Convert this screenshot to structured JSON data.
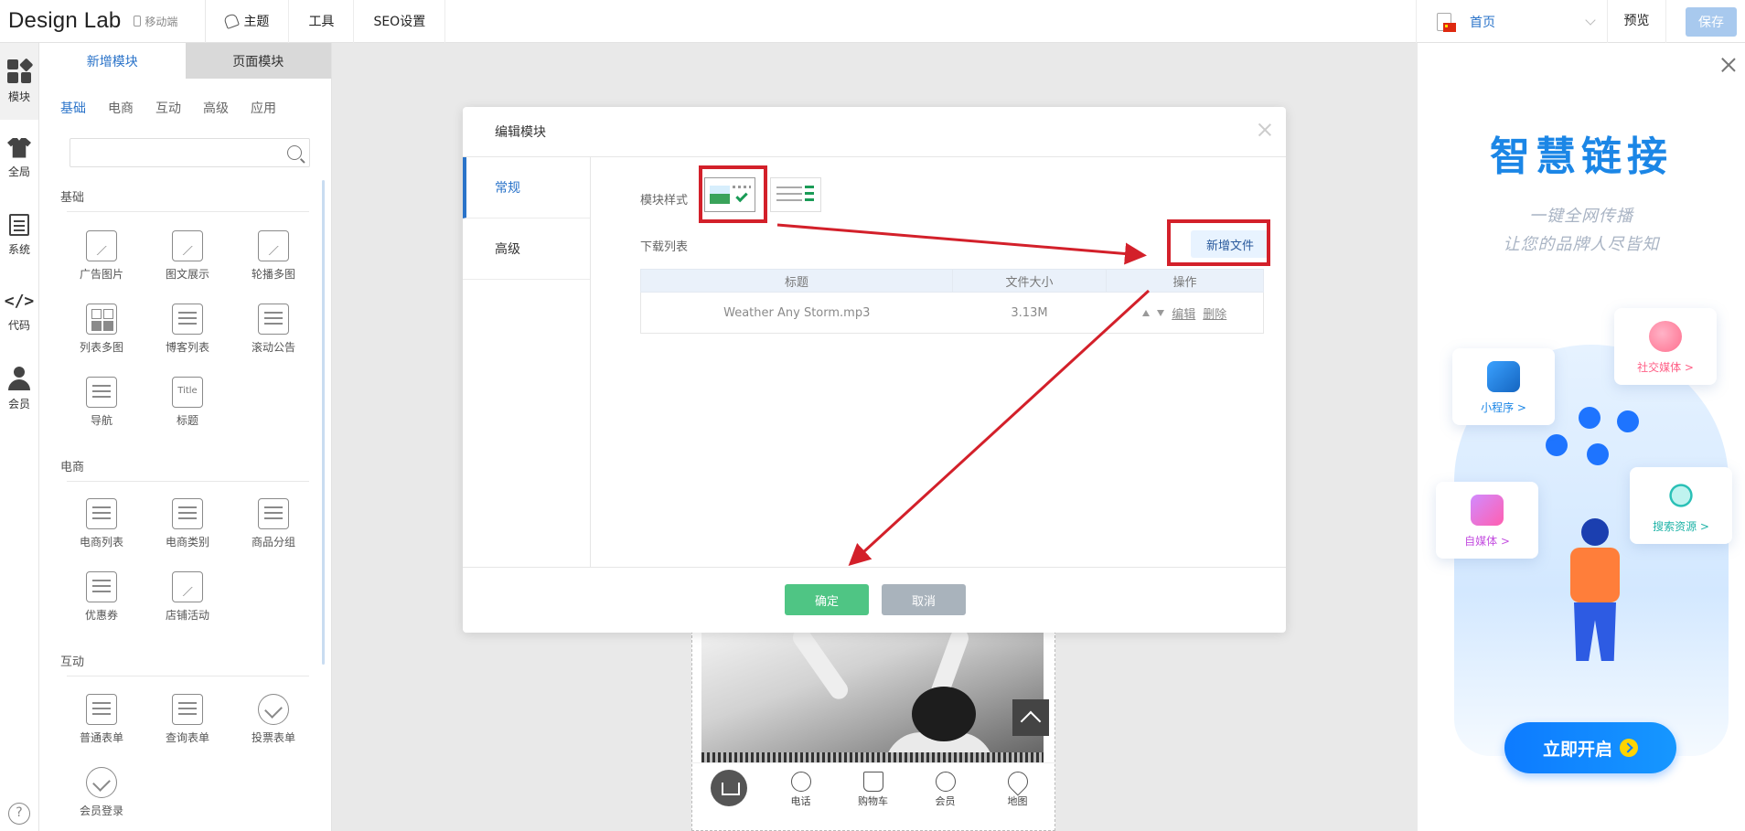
{
  "header": {
    "brand": "Design Lab",
    "mobile_label": "移动端",
    "menu": [
      {
        "label": "主题"
      },
      {
        "label": "工具"
      },
      {
        "label": "SEO设置"
      }
    ],
    "language": "首页",
    "preview_label": "预览",
    "save_label": "保存"
  },
  "rail": {
    "items": [
      {
        "label": "模块",
        "icon": "modules-icon"
      },
      {
        "label": "全局",
        "icon": "shirt-icon"
      },
      {
        "label": "系统",
        "icon": "document-icon"
      },
      {
        "label": "代码",
        "icon": "code-icon",
        "glyph": "</>"
      },
      {
        "label": "会员",
        "icon": "user-icon"
      }
    ],
    "help": "?"
  },
  "module_panel": {
    "tabs": [
      {
        "label": "新增模块"
      },
      {
        "label": "页面模块"
      }
    ],
    "subtabs": [
      {
        "label": "基础"
      },
      {
        "label": "电商"
      },
      {
        "label": "互动"
      },
      {
        "label": "高级"
      },
      {
        "label": "应用"
      }
    ],
    "search_placeholder": "",
    "sections": [
      {
        "title": "基础",
        "items": [
          {
            "label": "广告图片"
          },
          {
            "label": "图文展示"
          },
          {
            "label": "轮播多图"
          },
          {
            "label": "列表多图"
          },
          {
            "label": "博客列表"
          },
          {
            "label": "滚动公告"
          },
          {
            "label": "导航"
          },
          {
            "label": "标题"
          }
        ]
      },
      {
        "title": "电商",
        "items": [
          {
            "label": "电商列表"
          },
          {
            "label": "电商类别"
          },
          {
            "label": "商品分组"
          },
          {
            "label": "优惠券"
          },
          {
            "label": "店铺活动"
          }
        ]
      },
      {
        "title": "互动",
        "items": [
          {
            "label": "普通表单"
          },
          {
            "label": "查询表单"
          },
          {
            "label": "投票表单"
          },
          {
            "label": "会员登录"
          }
        ]
      }
    ]
  },
  "phone_nav": [
    {
      "label": ""
    },
    {
      "label": "电话"
    },
    {
      "label": "购物车"
    },
    {
      "label": "会员"
    },
    {
      "label": "地图"
    }
  ],
  "modal": {
    "title": "编辑模块",
    "side": [
      {
        "label": "常规"
      },
      {
        "label": "高级"
      }
    ],
    "style_label": "模块样式",
    "list_label": "下载列表",
    "add_file": "新增文件",
    "columns": [
      "标题",
      "文件大小",
      "操作"
    ],
    "rows": [
      {
        "title": "Weather Any Storm.mp3",
        "size": "3.13M",
        "edit": "编辑",
        "delete": "删除"
      }
    ],
    "ok": "确定",
    "cancel": "取消"
  },
  "promo": {
    "title": "智慧链接",
    "sub1": "一键全网传播",
    "sub2": "让您的品牌人尽皆知",
    "cards": [
      {
        "label": "小程序 >",
        "color": "#1b86e6"
      },
      {
        "label": "社交媒体 >",
        "color": "#ff5f86"
      },
      {
        "label": "自媒体 >",
        "color": "#c44fe0"
      },
      {
        "label": "搜索资源 >",
        "color": "#1fb3a7"
      }
    ],
    "cta": "立即开启"
  },
  "colors": {
    "accent": "#2a73c9",
    "ok": "#4fc584",
    "annotation": "#d3202a"
  }
}
